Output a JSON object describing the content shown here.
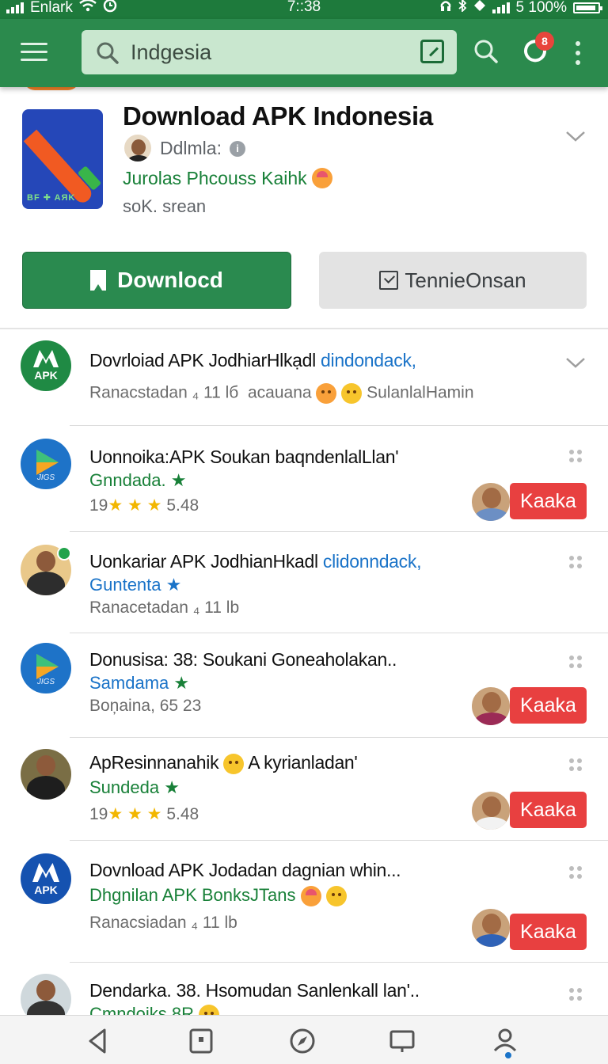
{
  "status_bar": {
    "carrier": "Enlark",
    "time": "7::38",
    "battery_text": "5 100%"
  },
  "app_bar": {
    "search_value": "Indgesia",
    "notification_badge": "8"
  },
  "header": {
    "title": "Download APK Indonesia",
    "developer": "Ddlmla:",
    "category": "Jurolas Phcouss Kaihk",
    "size": "soK. srean",
    "icon_tag": "BF ✚ AЯK",
    "download_label": "Downlocd",
    "secondary_label": "TennieOnsan"
  },
  "list": {
    "items": [
      {
        "title": "Dovrloiad APK JodhiarHlkạdl",
        "title_link": "dindondack,",
        "meta": "Ranacstadan ₄ 11 lб",
        "meta_extra": "acauana",
        "meta_tail": "SulanlalHamin",
        "icon_label": "APK"
      },
      {
        "title": "Uonnoika:APK Soukan baqndenlalLlan'",
        "sub": "Gnndada.",
        "rating_prefix": "19",
        "rating_value": "5.48",
        "action": "Kaaka",
        "icon_label": "JIGS"
      },
      {
        "title": "Uonkariar APK JodhianHkadl",
        "title_link": "clidonndack,",
        "sub": "Guntenta",
        "meta": "Ranacetadan ₄ 11 lb"
      },
      {
        "title": "Donusisa: 38: Soukani Goneaholakan..",
        "sub": "Samdama",
        "meta": "Boņaina, 65 23",
        "action": "Kaaka",
        "icon_label": "JIGS"
      },
      {
        "title": "ApResinnanahik",
        "title_tail": "A kyrianladan'",
        "sub": "Sundeda",
        "rating_prefix": "19",
        "rating_value": "5.48",
        "action": "Kaaka"
      },
      {
        "title": "Dovnload APK Jodadan dagnian whin...",
        "sub": "Dhgnilan APK BonksJTans",
        "meta": "Ranacsiadan ₄ 11 lb",
        "action": "Kaaka",
        "icon_label": "APK"
      },
      {
        "title": "Dendarka. 38. Hsomudan Sanlenkall lan'..",
        "sub": "Cmndoiks 8R"
      }
    ]
  },
  "colors": {
    "app_bar": "#2b8a4d",
    "primary_button": "#2a8a4f",
    "action_red": "#e84040",
    "link_blue": "#1a73c8",
    "category_green": "#188038"
  }
}
